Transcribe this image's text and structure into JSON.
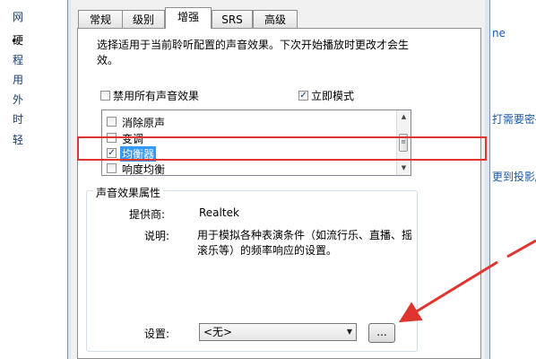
{
  "background_panel": {
    "nav_items": [
      "网",
      "硬",
      "程",
      "用",
      "外",
      "时",
      "轻"
    ],
    "right_links": [
      "ne",
      "打需要密码",
      "更到投影/"
    ]
  },
  "dialog": {
    "tabs": [
      {
        "label": "常规"
      },
      {
        "label": "级别"
      },
      {
        "label": "增强"
      },
      {
        "label": "SRS"
      },
      {
        "label": "高级"
      }
    ],
    "active_tab": "增强",
    "description_line1": "选择适用于当前聆听配置的声音效果。下次开始播放时更改才会生",
    "description_line2": "效。",
    "disable_all": {
      "label": "禁用所有声音效果",
      "checked": false
    },
    "immediate_mode": {
      "label": "立即模式",
      "checked": true
    },
    "effects": [
      {
        "label": "消除原声",
        "checked": false
      },
      {
        "label": "变调",
        "checked": false
      },
      {
        "label": "均衡器",
        "checked": true,
        "selected": true
      },
      {
        "label": "响度均衡",
        "checked": false
      }
    ],
    "properties": {
      "group_title": "声音效果属性",
      "provider_label": "提供商:",
      "provider_value": "Realtek",
      "description_label": "说明:",
      "description_value": "用于模拟各种表演条件（如流行乐、直播、摇滚乐等）的频率响应的设置。",
      "settings_label": "设置:",
      "settings_value": "<无>",
      "more_button_label": "..."
    }
  },
  "icons": {
    "check": "✓",
    "scroll_up": "▲",
    "scroll_down": "▼",
    "dropdown": "▼",
    "thumb_grip": "≡"
  },
  "colors": {
    "highlight": "#e0342e",
    "annotation_arrow": "#e0342e",
    "selection": "#3399ff"
  }
}
